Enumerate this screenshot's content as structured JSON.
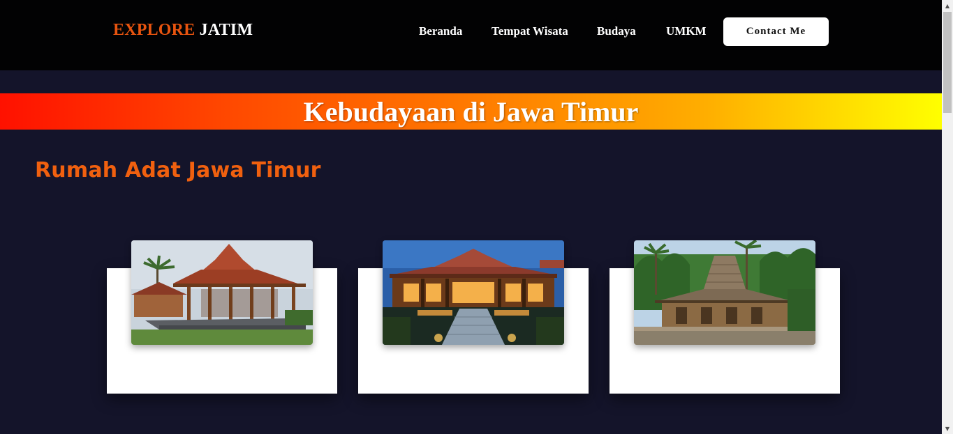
{
  "navbar": {
    "logo_part1": "EXPLORE",
    "logo_part2": "JATIM",
    "links": [
      "Beranda",
      "Tempat Wisata",
      "Budaya",
      "UMKM"
    ],
    "contact_label": "Contact Me"
  },
  "banner": {
    "title": "Kebudayaan di Jawa Timur"
  },
  "section": {
    "title": "Rumah Adat Jawa Timur"
  },
  "cards": [
    {
      "image": "joglo-pendopo-house-photo"
    },
    {
      "image": "joglo-house-night-photo"
    },
    {
      "image": "traditional-house-palms-photo"
    }
  ],
  "colors": {
    "accent": "#f0600f",
    "logo_orange": "#e8540f",
    "page_bg": "#14142a",
    "navbar_bg": "#020203",
    "banner_gradient_start": "#ff1100",
    "banner_gradient_end": "#ffff00"
  }
}
